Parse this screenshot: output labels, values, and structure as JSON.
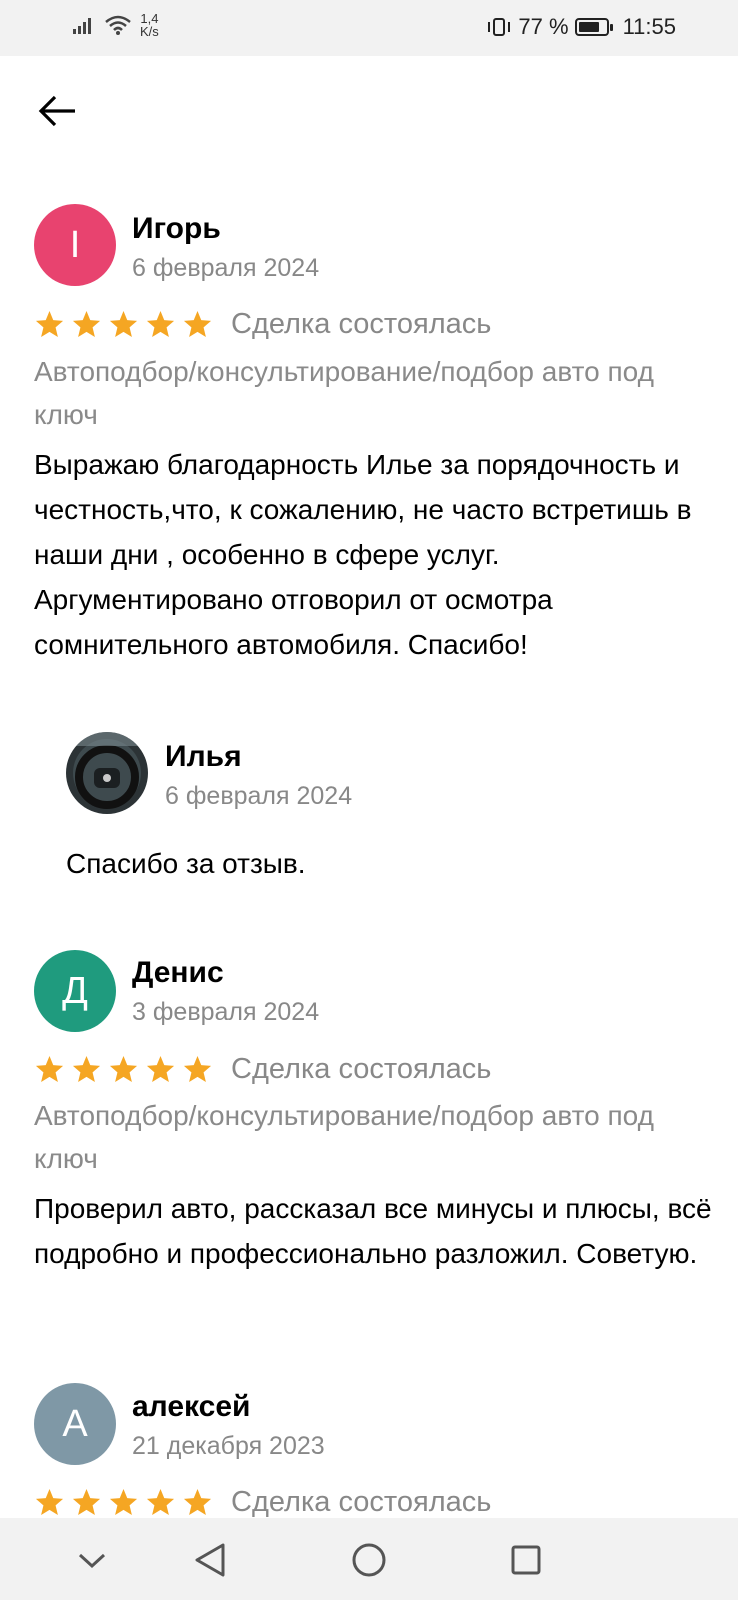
{
  "status_bar": {
    "net_speed_value": "1,4",
    "net_speed_unit": "K/s",
    "battery_percent": "77 %",
    "battery_level": 0.77,
    "time": "11:55",
    "icons": [
      "signal-icon",
      "wifi-icon",
      "vibrate-icon",
      "battery-icon"
    ]
  },
  "header": {
    "back_icon": "arrow-left-icon"
  },
  "reviews": [
    {
      "initial": "I",
      "avatar_color": "#e8436f",
      "name": "Игорь",
      "date": "6 февраля 2024",
      "rating": 5,
      "deal_status": "Сделка состоялась",
      "service": "Автоподбор/консультирование/подбор авто под ключ",
      "text": "Выражаю благодарность Илье за порядочность и честность,что, к сожалению, не часто встретишь в наши дни , особенно в сфере услуг. Аргументировано отговорил от осмотра сомнительного автомобиля. Спасибо!",
      "reply": {
        "name": "Илья",
        "date": "6 февраля 2024",
        "text": "Спасибо за отзыв."
      }
    },
    {
      "initial": "Д",
      "avatar_color": "#1f9b7e",
      "name": "Денис",
      "date": "3 февраля 2024",
      "rating": 5,
      "deal_status": "Сделка состоялась",
      "service": "Автоподбор/консультирование/подбор авто под ключ",
      "text": "Проверил авто, рассказал все минусы и плюсы, всё подробно и профессионально разложил.  Советую."
    },
    {
      "initial": "А",
      "avatar_color": "#7f98a6",
      "name": "алексей",
      "date": "21 декабря 2023",
      "rating": 5,
      "deal_status": "Сделка состоялась"
    }
  ],
  "colors": {
    "star": "#f5a623",
    "muted_text": "#888888"
  },
  "nav_bar": {
    "icons": [
      "chevron-down-icon",
      "back-triangle-icon",
      "home-circle-icon",
      "recents-square-icon"
    ]
  }
}
